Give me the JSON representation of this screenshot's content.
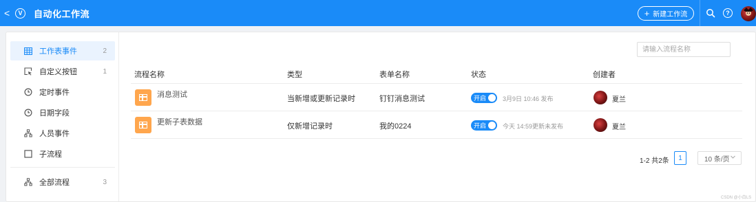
{
  "header": {
    "back_glyph": "<",
    "logo_glyph": "V",
    "title": "自动化工作流",
    "new_button_plus": "+",
    "new_button_label": "新建工作流",
    "help_glyph": "?",
    "background": "#1a8bf8"
  },
  "sidebar": {
    "items": [
      {
        "label": "工作表事件",
        "count": "2",
        "icon": "table-icon"
      },
      {
        "label": "自定义按钮",
        "count": "1",
        "icon": "cursor-button-icon"
      },
      {
        "label": "定时事件",
        "count": "",
        "icon": "clock-icon"
      },
      {
        "label": "日期字段",
        "count": "",
        "icon": "clock-icon"
      },
      {
        "label": "人员事件",
        "count": "",
        "icon": "org-icon"
      },
      {
        "label": "子流程",
        "count": "",
        "icon": "square-icon"
      }
    ],
    "all": {
      "label": "全部流程",
      "count": "3",
      "icon": "org-icon"
    }
  },
  "search": {
    "placeholder": "请输入流程名称"
  },
  "table": {
    "headers": {
      "name": "流程名称",
      "type": "类型",
      "form": "表单名称",
      "status": "状态",
      "creator": "创建者"
    },
    "rows": [
      {
        "name": "消息测试",
        "type": "当新增或更新记录时",
        "form": "钉钉消息测试",
        "toggle": "开启",
        "status_text": "3月9日 10:46 发布",
        "creator": "夏兰"
      },
      {
        "name": "更新子表数据",
        "type": "仅新增记录时",
        "form": "我的0224",
        "toggle": "开启",
        "status_text": "今天 14:59更新未发布",
        "creator": "夏兰"
      }
    ]
  },
  "pagination": {
    "total": "1-2 共2条",
    "current": "1",
    "page_size": "10 条/页"
  },
  "watermark": "CSDN @小白LS",
  "colors": {
    "accent": "#1a8bf8",
    "flow_icon": "#ffa64d"
  }
}
